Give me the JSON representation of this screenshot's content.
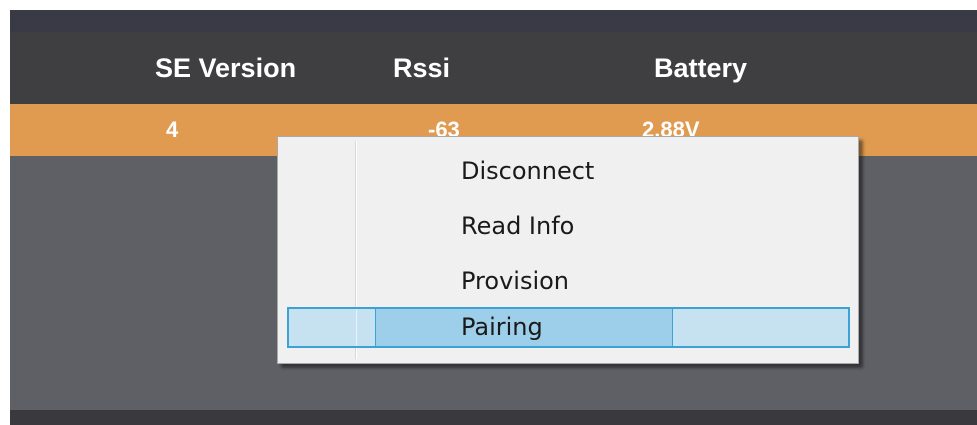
{
  "table": {
    "columns": [
      "SE Version",
      "Rssi",
      "Battery"
    ],
    "rows": [
      {
        "se_version": "4",
        "rssi": "-63",
        "battery": "2.88V",
        "selected": true
      }
    ]
  },
  "context_menu": {
    "items": [
      {
        "label": "Disconnect",
        "highlighted": false
      },
      {
        "label": "Read Info",
        "highlighted": false
      },
      {
        "label": "Provision",
        "highlighted": false
      },
      {
        "label": "Pairing",
        "highlighted": true
      }
    ]
  },
  "colors": {
    "header_bg": "#3f3f42",
    "selected_row": "#e09b51",
    "grid_bg": "#5f6065",
    "menu_bg": "#f0f0f0",
    "menu_highlight": "#9ecfea",
    "menu_highlight_border": "#3ca2d6"
  }
}
